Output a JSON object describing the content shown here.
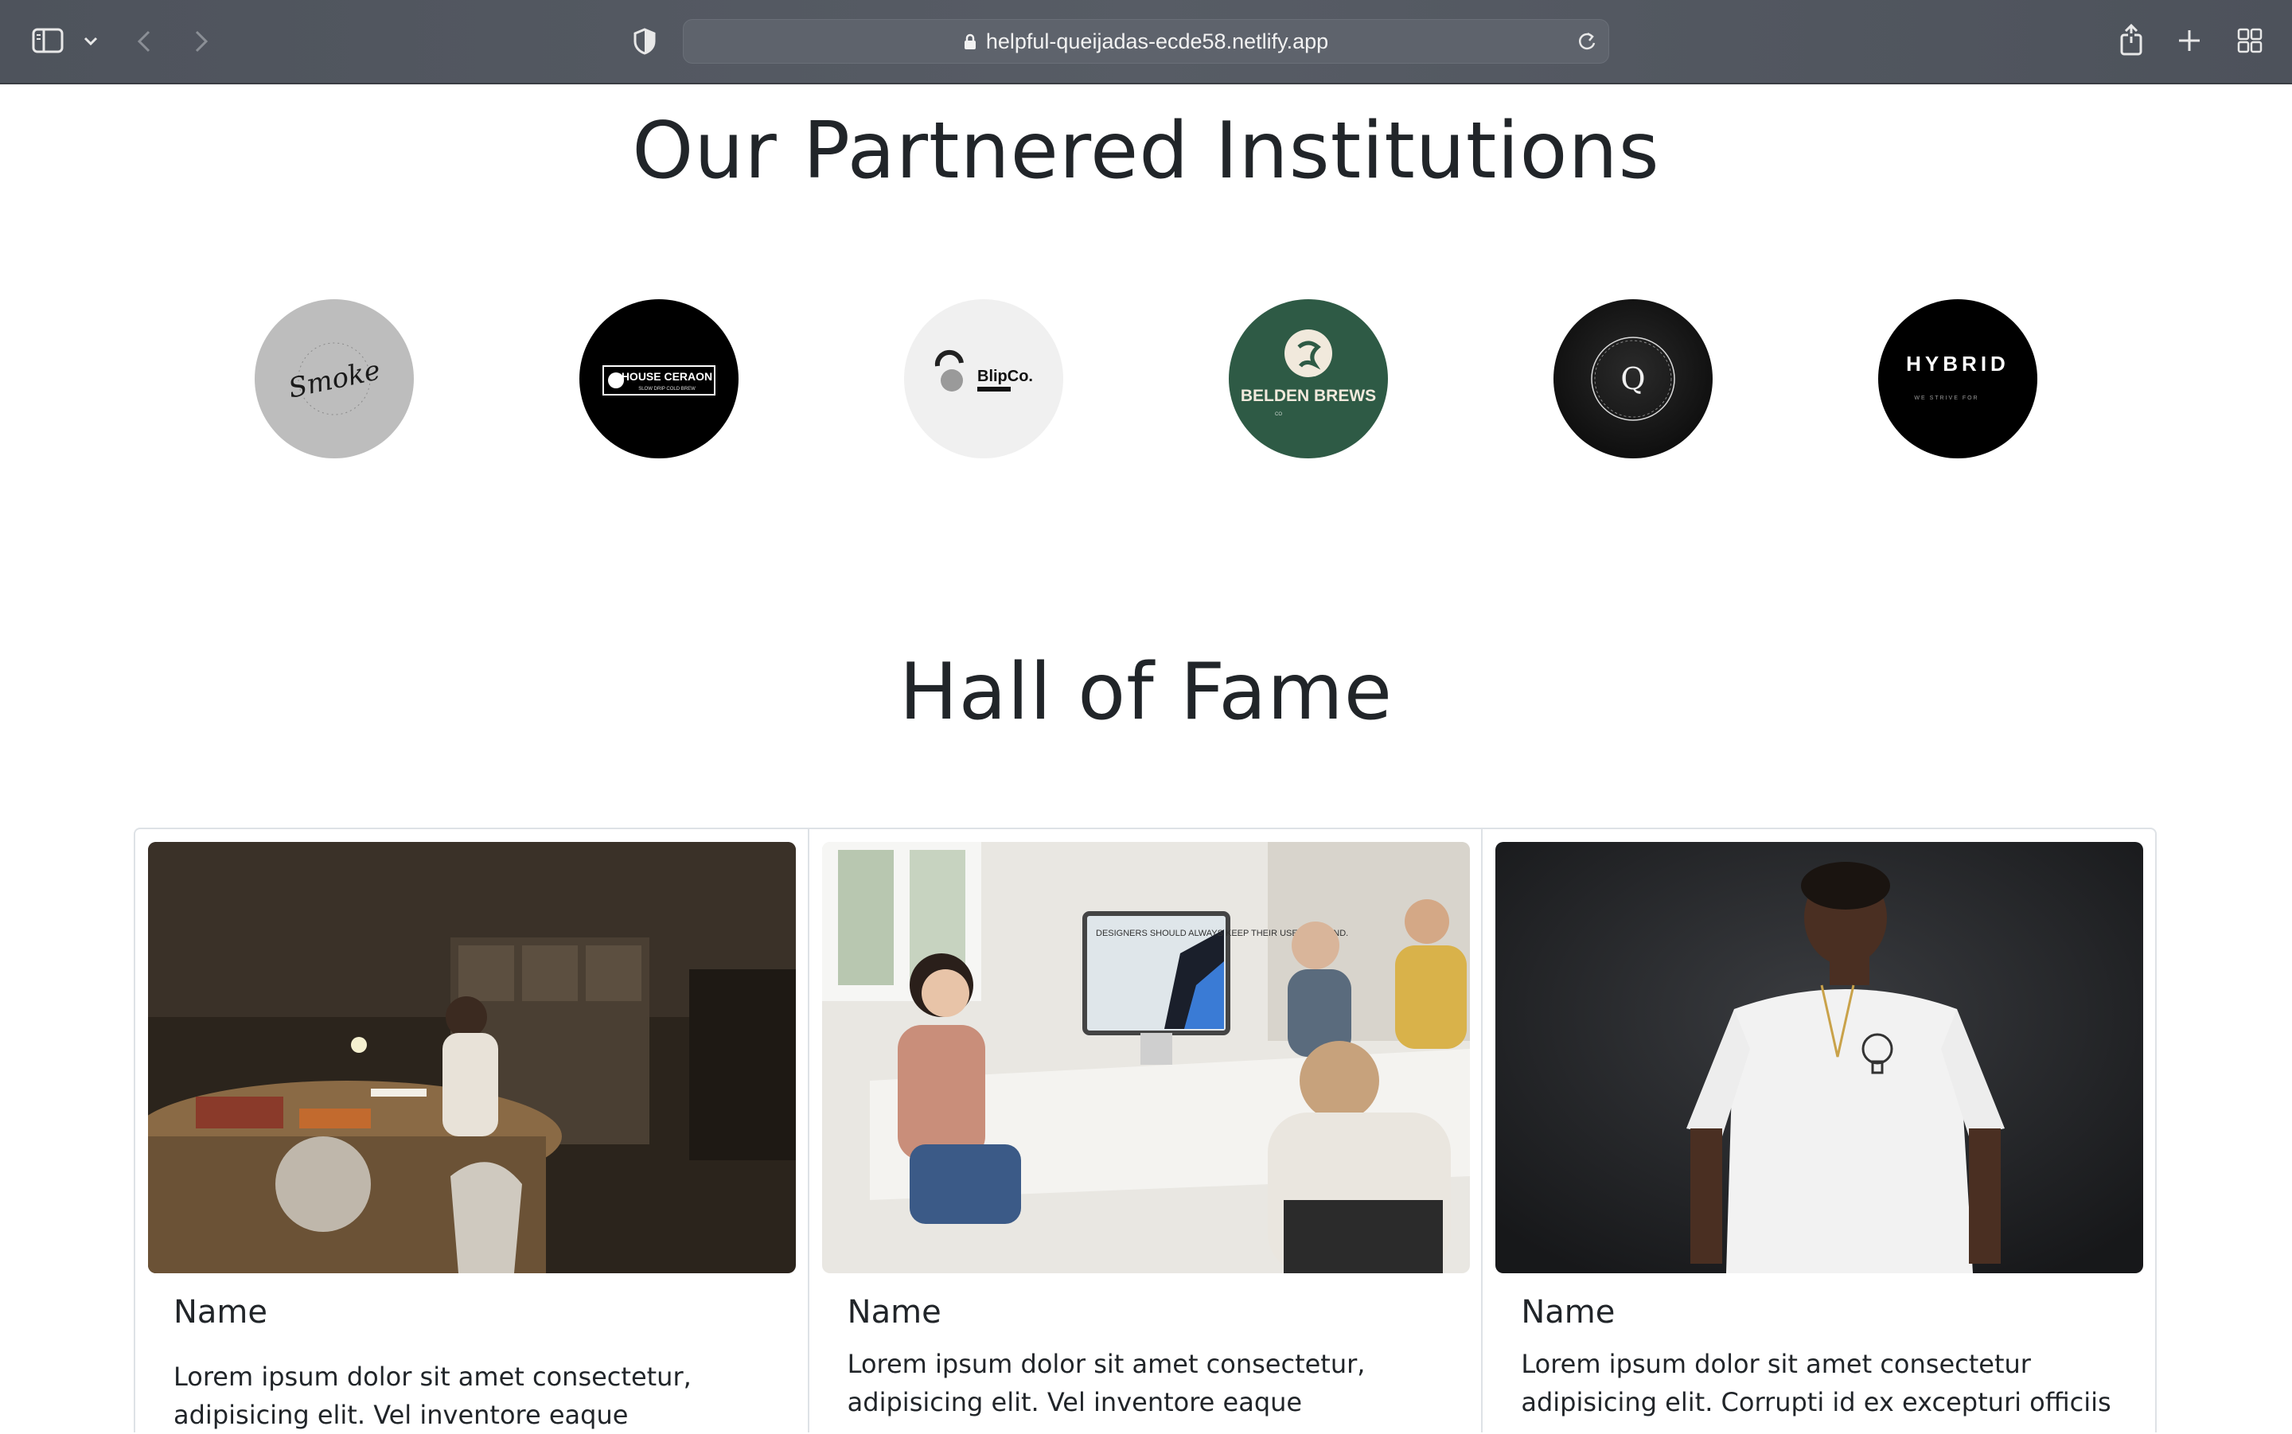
{
  "browser": {
    "url": "helpful-queijadas-ecde58.netlify.app",
    "icons": [
      "sidebar-icon",
      "chevron-down-icon",
      "back-icon",
      "forward-icon",
      "shield-icon",
      "lock-icon",
      "reload-icon",
      "share-icon",
      "new-tab-icon",
      "tab-overview-icon"
    ]
  },
  "partners": {
    "title": "Our Partnered Institutions",
    "logos": [
      {
        "name": "Smoke",
        "bg": "#bdbdbd"
      },
      {
        "name": "HOUSE CERAON",
        "tagline": "SLOW DRIP COLD BREW",
        "bg": "#000000"
      },
      {
        "name": "BlipCo.",
        "bg": "#f0f0f0"
      },
      {
        "name": "BELDEN BREWS",
        "bg": "#2e5a45"
      },
      {
        "name": "Q",
        "bg": "#111111"
      },
      {
        "name": "HYBRID",
        "tagline": "WE STRIVE FOR",
        "bg": "#000000"
      }
    ]
  },
  "hall": {
    "title": "Hall of Fame",
    "cards": [
      {
        "name": "Name",
        "text": "Lorem ipsum dolor sit amet consectetur, adipisicing elit. Vel inventore eaque"
      },
      {
        "name": "Name",
        "text": "Lorem ipsum dolor sit amet consectetur, adipisicing elit. Vel inventore eaque"
      },
      {
        "name": "Name",
        "text": "Lorem ipsum dolor sit amet consectetur adipisicing elit. Corrupti id ex excepturi officiis"
      }
    ],
    "monitor_text": "DESIGNERS SHOULD ALWAYS KEEP THEIR USERS IN MIND."
  }
}
